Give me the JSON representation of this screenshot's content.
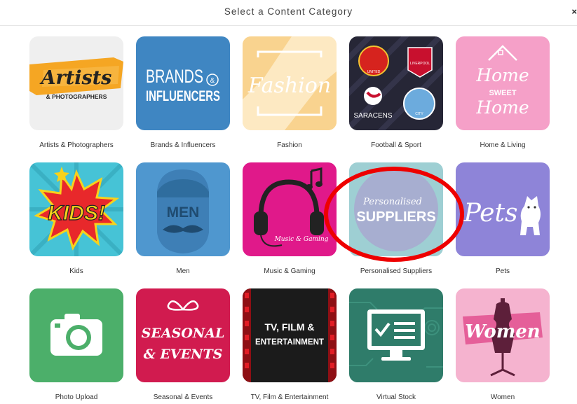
{
  "dialog": {
    "title": "Select a Content Category",
    "close_glyph": "×"
  },
  "categories": [
    {
      "label": "Artists & Photographers",
      "logo_line1": "Artists",
      "logo_line2": "& PHOTOGRAPHERS"
    },
    {
      "label": "Brands & Influencers",
      "logo_line1": "BRANDS",
      "logo_amp": "&",
      "logo_line2": "INFLUENCERS"
    },
    {
      "label": "Fashion",
      "logo_line1": "Fashion"
    },
    {
      "label": "Football & Sport",
      "logo_line1": "UNITED",
      "logo_line2": "LIVERPOOL",
      "logo_line3": "SARACENS",
      "logo_line4": "CITY"
    },
    {
      "label": "Home & Living",
      "logo_line1": "Home",
      "logo_line2": "SWEET",
      "logo_line3": "Home"
    },
    {
      "label": "Kids",
      "logo_line1": "KIDS!"
    },
    {
      "label": "Men",
      "logo_line1": "MEN"
    },
    {
      "label": "Music & Gaming",
      "logo_line1": "Music & Gaming"
    },
    {
      "label": "Personalised Suppliers",
      "logo_line1": "Personalised",
      "logo_line2": "SUPPLIERS"
    },
    {
      "label": "Pets",
      "logo_line1": "Pets"
    },
    {
      "label": "Photo Upload"
    },
    {
      "label": "Seasonal & Events",
      "logo_line1": "SEASONAL",
      "logo_line2": "& EVENTS"
    },
    {
      "label": "TV, Film & Entertainment",
      "logo_line1": "TV, FILM &",
      "logo_line2": "ENTERTAINMENT"
    },
    {
      "label": "Virtual Stock"
    },
    {
      "label": "Women",
      "logo_line1": "Women"
    }
  ],
  "highlight": {
    "target": "Personalised Suppliers",
    "color": "#ee0000"
  }
}
